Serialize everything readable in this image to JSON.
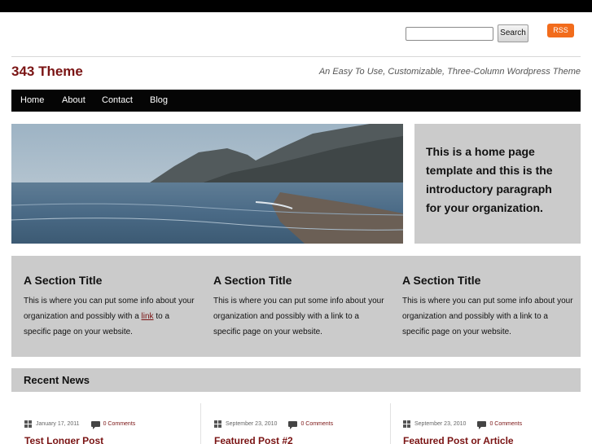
{
  "header": {
    "search": {
      "placeholder": "",
      "button_label": "Search"
    },
    "rss_label": "RSS",
    "site_title": "343 Theme",
    "tagline": "An Easy To Use, Customizable, Three-Column Wordpress Theme"
  },
  "nav": {
    "items": [
      {
        "label": "Home"
      },
      {
        "label": "About"
      },
      {
        "label": "Contact"
      },
      {
        "label": "Blog"
      }
    ]
  },
  "hero": {
    "intro": "This is a home page template and this is the introductory paragraph for your organization."
  },
  "sections": [
    {
      "title": "A Section Title",
      "body_before": "This is where you can put some info about your organization and possibly with a ",
      "link": "link",
      "body_after": " to a specific page on your website."
    },
    {
      "title": "A Section Title",
      "body": "This is where you can put some info about your organization and possibly with a link to a specific page on your website."
    },
    {
      "title": "A Section Title",
      "body": "This is where you can put some info about your organization and possibly with a link to a specific page on your website."
    }
  ],
  "recent_news": {
    "title": "Recent News",
    "posts": [
      {
        "date": "January 17, 2011",
        "comments": "0 Comments",
        "title": "Test Longer Post"
      },
      {
        "date": "September 23, 2010",
        "comments": "0 Comments",
        "title": "Featured Post #2"
      },
      {
        "date": "September 23, 2010",
        "comments": "0 Comments",
        "title": "Featured Post or Article"
      }
    ]
  },
  "colors": {
    "accent": "#7a1414",
    "rss": "#f26c1c",
    "panel": "#cbcbcb",
    "nav": "#050505"
  }
}
